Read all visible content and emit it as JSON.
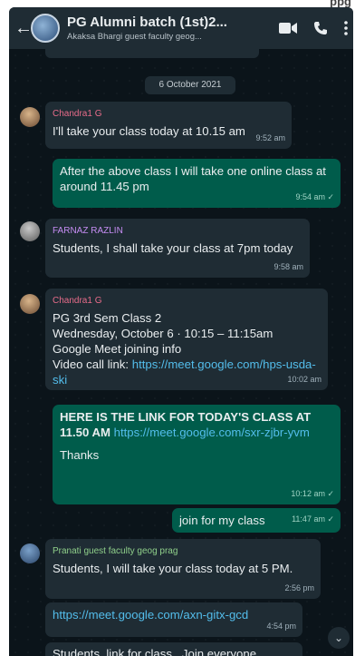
{
  "crop_text": "ppg",
  "header": {
    "title": "PG Alumni batch (1st)2...",
    "subtitle": "Akaksa Bhargi guest faculty geog..."
  },
  "date_chip": "6 October 2021",
  "messages": [
    {
      "sender": "Chandra1 G",
      "sender_color": "#e86c8a",
      "text": "I'll take your class today at 10.15 am",
      "time": "9:52 am"
    },
    {
      "text": "After the above class I will take one online class at around 11.45 pm",
      "time": "9:54 am ✓"
    },
    {
      "sender": "FARNAZ RAZLIN",
      "sender_color": "#c58cf2",
      "text": "Students, I shall take your class at 7pm today",
      "time": "9:58 am"
    },
    {
      "sender": "Chandra1 G",
      "sender_color": "#e86c8a",
      "lines": [
        "PG 3rd Sem Class 2",
        "Wednesday, October 6 · 10:15 – 11:15am",
        "Google Meet joining info",
        "Video call link: "
      ],
      "link": "https://meet.google.com/hps-usda-ski",
      "time": "10:02 am"
    },
    {
      "text_bold": "HERE IS THE LINK FOR TODAY'S CLASS AT 11.50 AM",
      "link": "https://meet.google.com/sxr-zjbr-yvm",
      "text_after": "Thanks",
      "time": "10:12 am ✓"
    },
    {
      "text": "join for my class",
      "time": "11:47 am ✓"
    },
    {
      "sender": "Pranati guest faculty geog prag",
      "sender_color": "#8fcf8a",
      "text": "Students, I will take your class today at 5 PM.",
      "time": "2:56 pm"
    },
    {
      "link": "https://meet.google.com/axn-gitx-gcd",
      "time": "4:54 pm"
    },
    {
      "text": "Students, link for class , Join everyone"
    }
  ],
  "colors": {
    "incoming_bubble": "#1f2c34",
    "outgoing_bubble": "#005c4b",
    "link": "#53bdeb",
    "background": "#0b141a"
  }
}
